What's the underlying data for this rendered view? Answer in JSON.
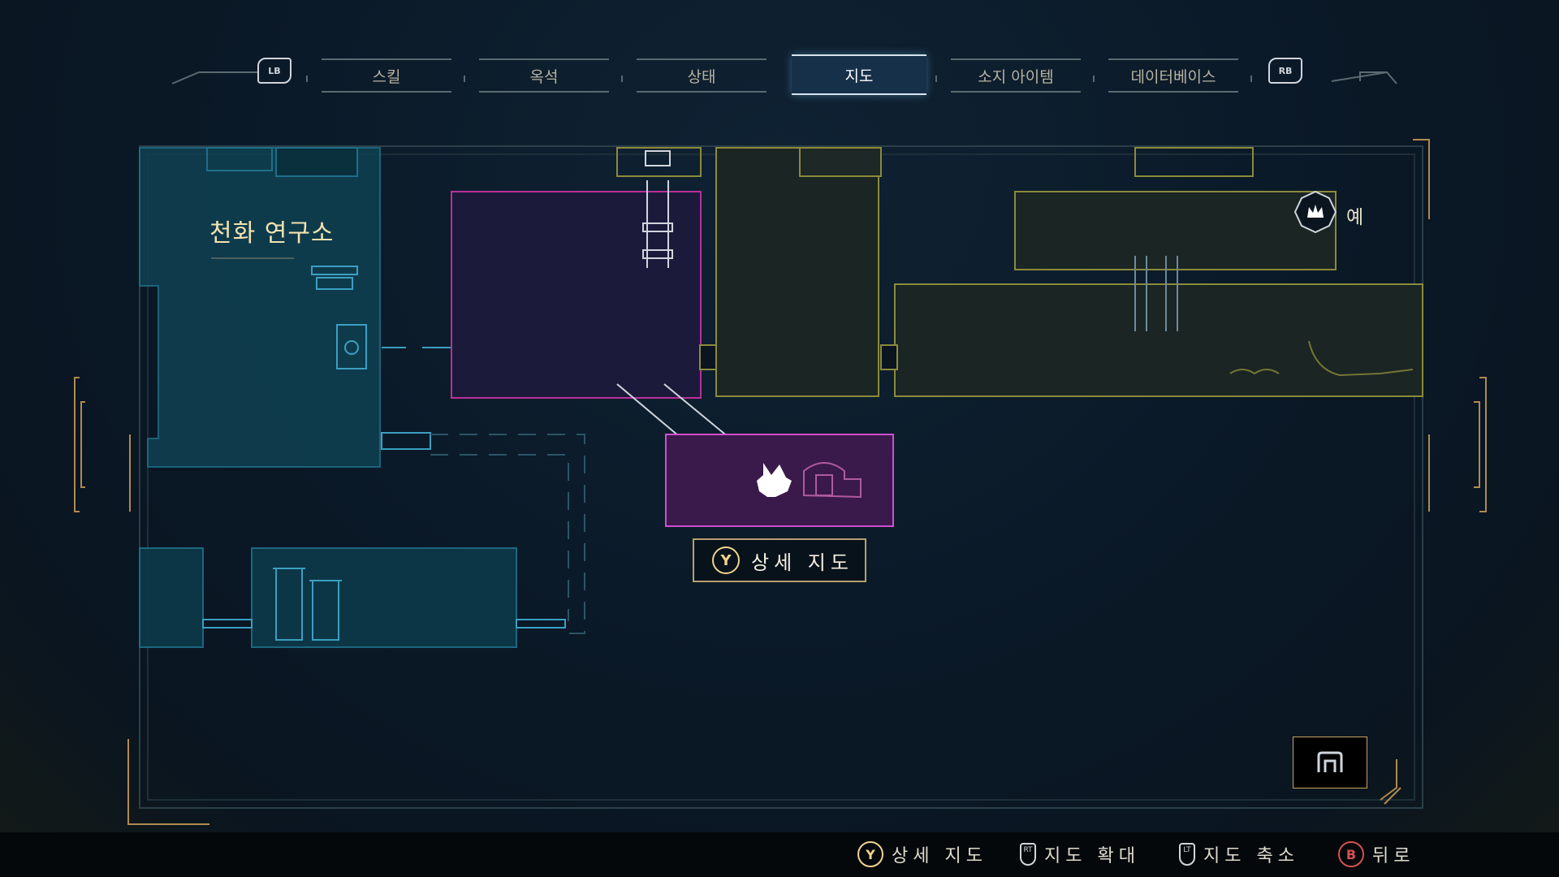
{
  "nav": {
    "left_bumper": "LB",
    "right_bumper": "RB",
    "tabs": [
      {
        "label": "스킬"
      },
      {
        "label": "옥석"
      },
      {
        "label": "상태"
      },
      {
        "label": "지도",
        "active": true
      },
      {
        "label": "소지 아이템"
      },
      {
        "label": "데이터베이스"
      }
    ]
  },
  "map": {
    "area_name": "천화 연구소",
    "npc_label": "예",
    "detail_prompt": {
      "button": "Y",
      "label": "상세 지도"
    }
  },
  "hints": [
    {
      "button": "Y",
      "label": "상세 지도"
    },
    {
      "button": "RT",
      "label": "지도 확대"
    },
    {
      "button": "LT",
      "label": "지도 축소"
    },
    {
      "button": "B",
      "label": "뒤로"
    }
  ],
  "colors": {
    "accent_gold": "#c9a460",
    "room_cyan": "#1e6f8a",
    "room_magenta": "#c8389a",
    "room_olive": "#8c8a3a"
  }
}
